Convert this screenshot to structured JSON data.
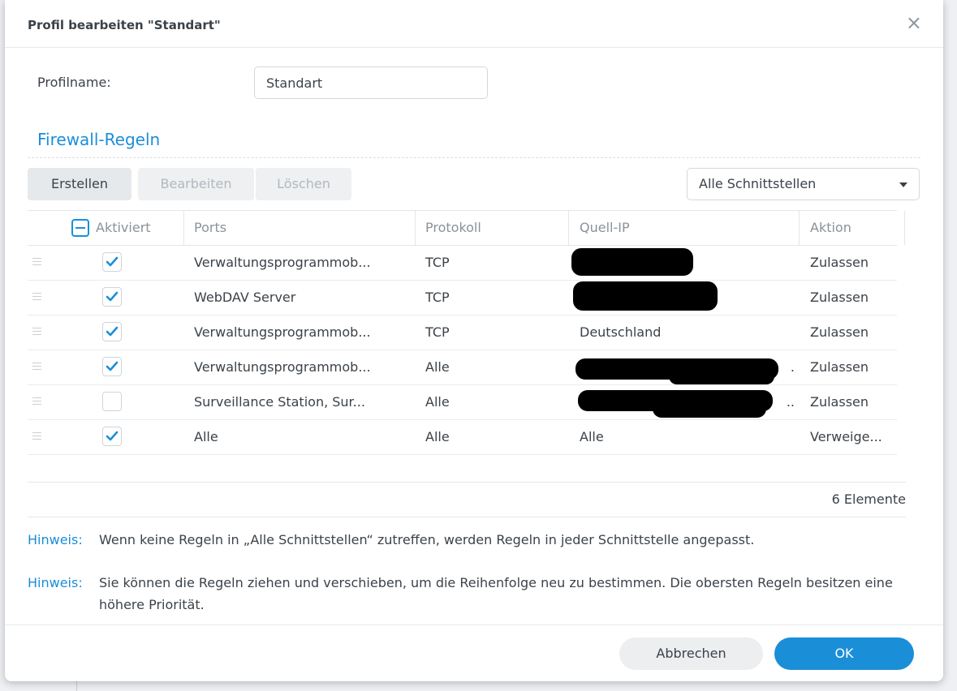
{
  "dialog": {
    "title": "Profil bearbeiten \"Standart\"",
    "close_icon": "×"
  },
  "profile": {
    "label": "Profilname:",
    "value": "Standart"
  },
  "section": {
    "title": "Firewall-Regeln"
  },
  "toolbar": {
    "create_label": "Erstellen",
    "edit_label": "Bearbeiten",
    "delete_label": "Löschen",
    "interface_select": "Alle Schnittstellen"
  },
  "table": {
    "columns": {
      "enabled": "Aktiviert",
      "ports": "Ports",
      "protocol": "Protokoll",
      "source_ip": "Quell-IP",
      "action": "Aktion"
    },
    "rows": [
      {
        "enabled": true,
        "ports": "Verwaltungsprogrammob...",
        "protocol": "TCP",
        "source_ip": "",
        "action": "Zulassen"
      },
      {
        "enabled": true,
        "ports": "WebDAV Server",
        "protocol": "TCP",
        "source_ip": "",
        "action": "Zulassen"
      },
      {
        "enabled": true,
        "ports": "Verwaltungsprogrammob...",
        "protocol": "TCP",
        "source_ip": "Deutschland",
        "action": "Zulassen"
      },
      {
        "enabled": true,
        "ports": "Verwaltungsprogrammob...",
        "protocol": "Alle",
        "source_ip": ".",
        "action": "Zulassen"
      },
      {
        "enabled": false,
        "ports": "Surveillance Station, Sur...",
        "protocol": "Alle",
        "source_ip": "..",
        "action": "Zulassen"
      },
      {
        "enabled": true,
        "ports": "Alle",
        "protocol": "Alle",
        "source_ip": "Alle",
        "action": "Verweige..."
      }
    ],
    "count_text": "6 Elemente"
  },
  "hints": [
    {
      "label": "Hinweis:",
      "text": "Wenn keine Regeln in „Alle Schnittstellen“ zutreffen, werden Regeln in jeder Schnittstelle angepasst."
    },
    {
      "label": "Hinweis:",
      "text": "Sie können die Regeln ziehen und verschieben, um die Reihenfolge neu zu bestimmen. Die obersten Regeln besitzen eine höhere Priorität."
    }
  ],
  "footer": {
    "cancel_label": "Abbrechen",
    "ok_label": "OK"
  },
  "colors": {
    "accent": "#1b8ed8",
    "text": "#3b4249",
    "muted": "#8a9299"
  }
}
